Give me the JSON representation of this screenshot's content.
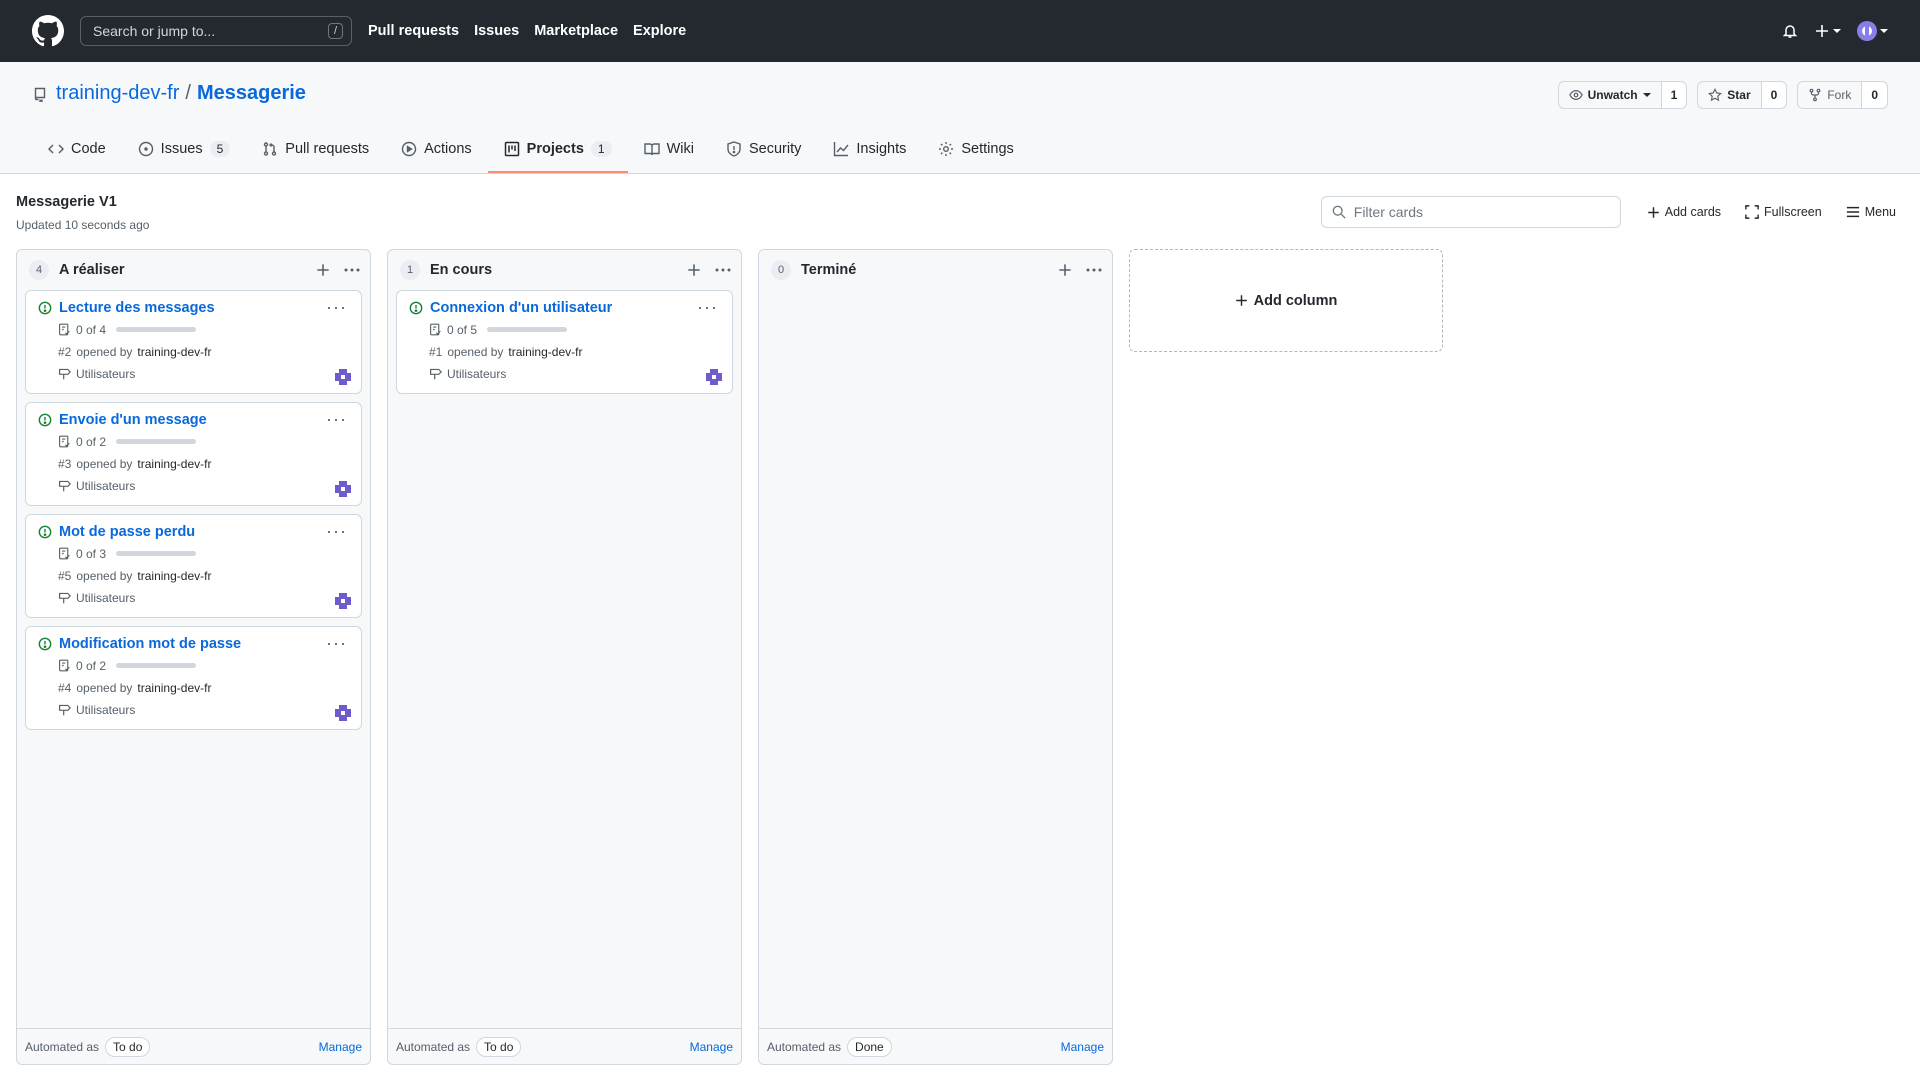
{
  "topbar": {
    "search_placeholder": "Search or jump to...",
    "search_shortcut": "/",
    "nav": [
      "Pull requests",
      "Issues",
      "Marketplace",
      "Explore"
    ]
  },
  "repo": {
    "owner": "training-dev-fr",
    "separator": "/",
    "name": "Messagerie",
    "unwatch_label": "Unwatch",
    "watch_count": "1",
    "star_label": "Star",
    "star_count": "0",
    "fork_label": "Fork",
    "fork_count": "0"
  },
  "tabs": {
    "code": "Code",
    "issues": "Issues",
    "issues_count": "5",
    "pulls": "Pull requests",
    "actions": "Actions",
    "projects": "Projects",
    "projects_count": "1",
    "wiki": "Wiki",
    "security": "Security",
    "insights": "Insights",
    "settings": "Settings"
  },
  "project": {
    "title": "Messagerie V1",
    "updated": "Updated 10 seconds ago",
    "filter_placeholder": "Filter cards",
    "add_cards": "Add cards",
    "fullscreen": "Fullscreen",
    "menu": "Menu",
    "add_column": "Add column"
  },
  "columns": [
    {
      "name": "A réaliser",
      "count": "4",
      "automated_label": "Automated as",
      "automated_value": "To do",
      "manage": "Manage",
      "cards": [
        {
          "title": "Lecture des messages",
          "tasks": "0 of 4",
          "progress": 0,
          "number": "#2",
          "opened_by": "opened by",
          "author": "training-dev-fr",
          "milestone": "Utilisateurs"
        },
        {
          "title": "Envoie d'un message",
          "tasks": "0 of 2",
          "progress": 0,
          "number": "#3",
          "opened_by": "opened by",
          "author": "training-dev-fr",
          "milestone": "Utilisateurs"
        },
        {
          "title": "Mot de passe perdu",
          "tasks": "0 of 3",
          "progress": 0,
          "number": "#5",
          "opened_by": "opened by",
          "author": "training-dev-fr",
          "milestone": "Utilisateurs"
        },
        {
          "title": "Modification mot de passe",
          "tasks": "0 of 2",
          "progress": 0,
          "number": "#4",
          "opened_by": "opened by",
          "author": "training-dev-fr",
          "milestone": "Utilisateurs"
        }
      ]
    },
    {
      "name": "En cours",
      "count": "1",
      "automated_label": "Automated as",
      "automated_value": "To do",
      "manage": "Manage",
      "cards": [
        {
          "title": "Connexion d'un utilisateur",
          "tasks": "0 of 5",
          "progress": 0,
          "number": "#1",
          "opened_by": "opened by",
          "author": "training-dev-fr",
          "milestone": "Utilisateurs"
        }
      ]
    },
    {
      "name": "Terminé",
      "count": "0",
      "automated_label": "Automated as",
      "automated_value": "Done",
      "manage": "Manage",
      "cards": []
    }
  ],
  "colors": {
    "header_bg": "#24292f",
    "link": "#0969da",
    "issue_open": "#1a7f37",
    "tab_underline": "#fd8c73",
    "avatar": "#6e5ccf"
  }
}
